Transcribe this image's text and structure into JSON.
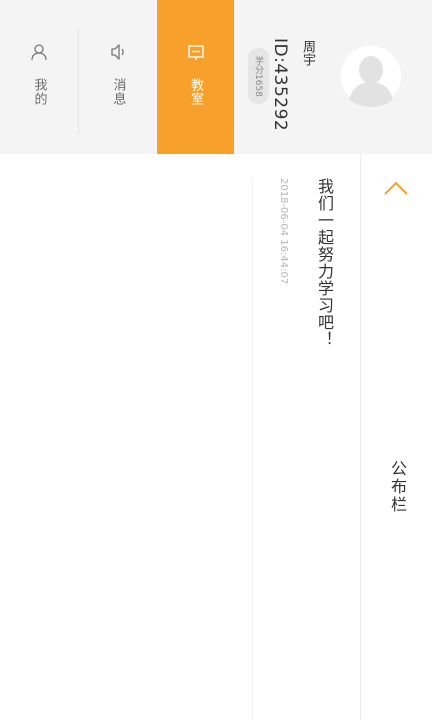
{
  "nav": {
    "mine": {
      "label": "我的",
      "icon": "person-icon"
    },
    "messages": {
      "label": "消息",
      "icon": "speaker-icon"
    },
    "classroom": {
      "label": "教室",
      "icon": "classroom-icon",
      "active": true
    }
  },
  "profile": {
    "name": "周宇",
    "id": "ID:435292",
    "credits": "学分1658"
  },
  "bulletin": {
    "title": "公布栏",
    "notice_text": "我们一起努力学习吧！",
    "notice_time": "2018-06-04 16:44:07"
  },
  "colors": {
    "accent": "#f7a12c",
    "nav_background": "#f4f4f4"
  }
}
